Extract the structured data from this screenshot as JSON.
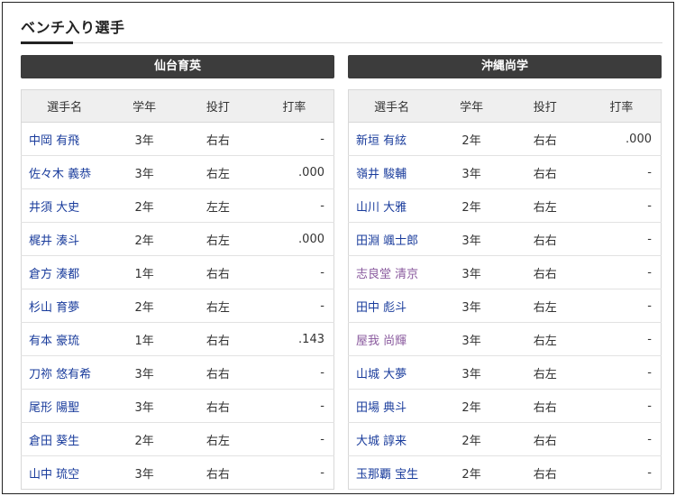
{
  "section": {
    "title": "ベンチ入り選手"
  },
  "columns": {
    "name": "選手名",
    "grade": "学年",
    "hand": "投打",
    "avg": "打率"
  },
  "teams": [
    {
      "name": "仙台育英",
      "players": [
        {
          "name": "中岡 有飛",
          "grade": "3年",
          "hand": "右右",
          "avg": "-",
          "visited": false
        },
        {
          "name": "佐々木 義恭",
          "grade": "3年",
          "hand": "右左",
          "avg": ".000",
          "visited": false
        },
        {
          "name": "井須 大史",
          "grade": "2年",
          "hand": "左左",
          "avg": "-",
          "visited": false
        },
        {
          "name": "梶井 湊斗",
          "grade": "2年",
          "hand": "右左",
          "avg": ".000",
          "visited": false
        },
        {
          "name": "倉方 湊都",
          "grade": "1年",
          "hand": "右右",
          "avg": "-",
          "visited": false
        },
        {
          "name": "杉山 育夢",
          "grade": "2年",
          "hand": "右左",
          "avg": "-",
          "visited": false
        },
        {
          "name": "有本 豪琉",
          "grade": "1年",
          "hand": "右右",
          "avg": ".143",
          "visited": false
        },
        {
          "name": "刀祢 悠有希",
          "grade": "3年",
          "hand": "右右",
          "avg": "-",
          "visited": false
        },
        {
          "name": "尾形 陽聖",
          "grade": "3年",
          "hand": "右右",
          "avg": "-",
          "visited": false
        },
        {
          "name": "倉田 葵生",
          "grade": "2年",
          "hand": "右左",
          "avg": "-",
          "visited": false
        },
        {
          "name": "山中 琉空",
          "grade": "3年",
          "hand": "右右",
          "avg": "-",
          "visited": false
        }
      ]
    },
    {
      "name": "沖縄尚学",
      "players": [
        {
          "name": "新垣 有絃",
          "grade": "2年",
          "hand": "右右",
          "avg": ".000",
          "visited": false
        },
        {
          "name": "嶺井 駿輔",
          "grade": "3年",
          "hand": "右右",
          "avg": "-",
          "visited": false
        },
        {
          "name": "山川 大雅",
          "grade": "2年",
          "hand": "右左",
          "avg": "-",
          "visited": false
        },
        {
          "name": "田淵 颯士郎",
          "grade": "3年",
          "hand": "右右",
          "avg": "-",
          "visited": false
        },
        {
          "name": "志良堂 清京",
          "grade": "3年",
          "hand": "右右",
          "avg": "-",
          "visited": true
        },
        {
          "name": "田中 彪斗",
          "grade": "3年",
          "hand": "右左",
          "avg": "-",
          "visited": false
        },
        {
          "name": "屋我 尚輝",
          "grade": "3年",
          "hand": "右左",
          "avg": "-",
          "visited": true
        },
        {
          "name": "山城 大夢",
          "grade": "3年",
          "hand": "右左",
          "avg": "-",
          "visited": false
        },
        {
          "name": "田場 典斗",
          "grade": "2年",
          "hand": "右右",
          "avg": "-",
          "visited": false
        },
        {
          "name": "大城 諄来",
          "grade": "2年",
          "hand": "右右",
          "avg": "-",
          "visited": false
        },
        {
          "name": "玉那覇 宝生",
          "grade": "2年",
          "hand": "右右",
          "avg": "-",
          "visited": false
        }
      ]
    }
  ]
}
